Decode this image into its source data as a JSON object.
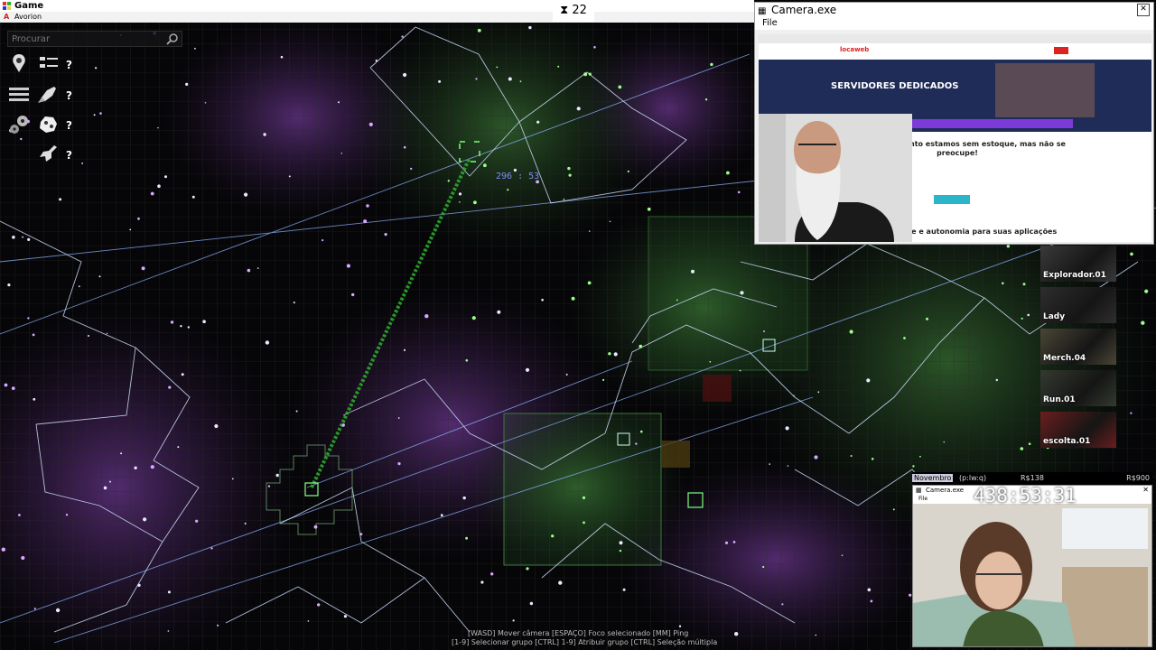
{
  "window": {
    "title": "Game",
    "subtitle": "Avorion"
  },
  "timer": {
    "icon": "hourglass-icon",
    "value": "22"
  },
  "search": {
    "placeholder": "Procurar"
  },
  "map_marker": {
    "label": "296 : 53"
  },
  "camera": {
    "title": "Camera.exe",
    "menu": "File",
    "browser": {
      "logo": "locaweb",
      "heading": "SERVIDORES DEDICADOS",
      "notice": "Opa! No momento estamos sem estoque, mas não se preocupe!",
      "footer": "ade e autonomia para suas aplicações"
    }
  },
  "fleet": [
    {
      "name": "Explorador.01"
    },
    {
      "name": "Lady"
    },
    {
      "name": "Merch.04"
    },
    {
      "name": "Run.01"
    },
    {
      "name": "escolta.01"
    }
  ],
  "overlay": {
    "month": "Novembro",
    "handle": "(p:lw:q)",
    "amount_left": "R$138",
    "amount_right": "R$900",
    "clock": "438:53:31",
    "camera_title": "Camera.exe",
    "camera_menu": "File"
  },
  "hints": {
    "line1": "[WASD] Mover câmera     [ESPAÇO] Foco selecionado     [MM] Ping",
    "line2": "[1-9] Selecionar grupo     [CTRL] 1-9] Atribuir grupo     [CTRL] Seleção múltipla"
  },
  "colors": {
    "galaxy_purple": "#3a1d4f",
    "galaxy_green": "#1d3a1d",
    "route_line": "#8fb3ff",
    "star_green": "#9cff8c"
  }
}
